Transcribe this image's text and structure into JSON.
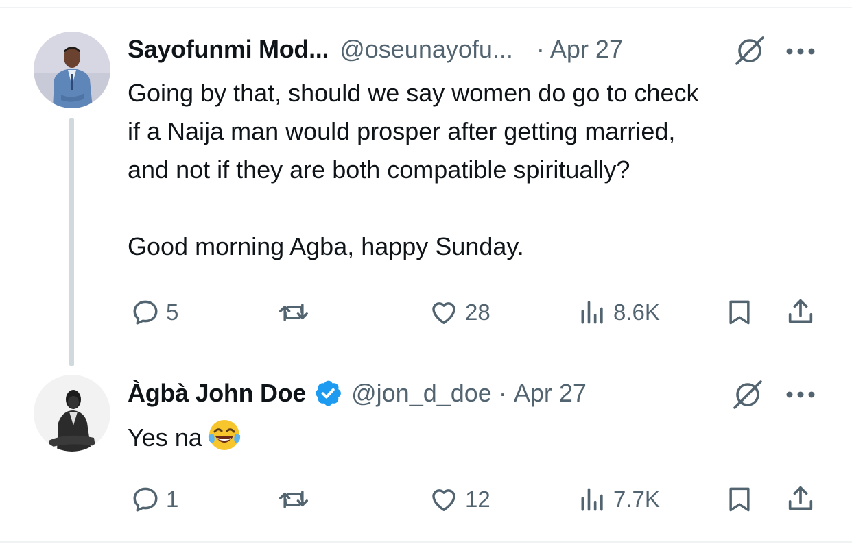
{
  "tweets": [
    {
      "author_name": "Sayofunmi Mod...",
      "handle": "@oseunayofu...",
      "separator": "·",
      "date": "Apr 27",
      "text": "Going by that, should we say women do go to check\nif a Naija man would prosper after getting married,\nand not if they are both compatible spiritually?\n\nGood morning Agba, happy Sunday.",
      "replies": "5",
      "retweets": "",
      "likes": "28",
      "views": "8.6K"
    },
    {
      "author_name": "Àgbà John Doe",
      "handle": "@jon_d_doe",
      "separator": "·",
      "date": "Apr 27",
      "text": "Yes na",
      "emoji": "face-with-tears-of-joy",
      "verified": true,
      "replies": "1",
      "retweets": "",
      "likes": "12",
      "views": "7.7K"
    }
  ],
  "colors": {
    "text": "#0f1419",
    "secondary": "#536471",
    "verified": "#1d9bf0",
    "thread_line": "#cfd9de"
  },
  "icons": [
    "reply-icon",
    "retweet-icon",
    "like-icon",
    "views-icon",
    "bookmark-icon",
    "share-icon",
    "grok-icon",
    "more-icon",
    "verified-badge-icon"
  ]
}
